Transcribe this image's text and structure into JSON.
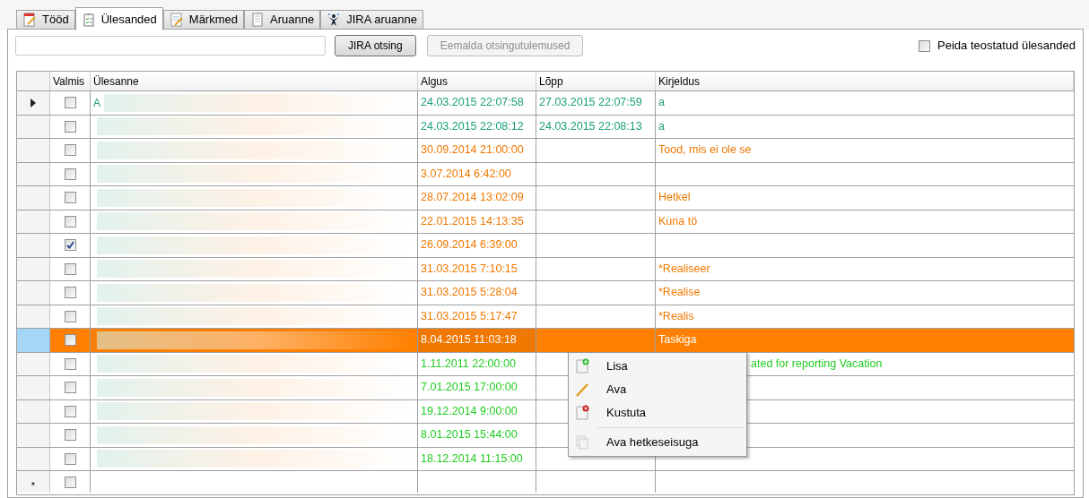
{
  "tabs": [
    {
      "label": "Tööd",
      "selected": false
    },
    {
      "label": "Ülesanded",
      "selected": true
    },
    {
      "label": "Märkmed",
      "selected": false
    },
    {
      "label": "Aruanne",
      "selected": false
    },
    {
      "label": "JIRA aruanne",
      "selected": false
    }
  ],
  "toolbar": {
    "buttons": [
      {
        "label": "JIRA otsing",
        "disabled": false
      },
      {
        "label": "Eemalda otsingutulemused",
        "disabled": true
      }
    ],
    "hide_done": {
      "label": "Peida teostatud ülesanded",
      "checked": false
    }
  },
  "grid": {
    "columns": [
      "Valmis",
      "Ülesanne",
      "Algus",
      "Lõpp",
      "Kirjeldus"
    ],
    "rows": [
      {
        "current": true,
        "selected": false,
        "done": false,
        "task": "A",
        "start": "24.03.2015 22:07:58",
        "end": "27.03.2015 22:07:59",
        "description": "a",
        "color": "#1a9e7a"
      },
      {
        "current": false,
        "selected": false,
        "done": false,
        "task": "",
        "start": "24.03.2015 22:08:12",
        "end": "24.03.2015 22:08:13",
        "description": "a",
        "color": "#1a9e7a"
      },
      {
        "current": false,
        "selected": false,
        "done": false,
        "task": "",
        "start": "30.09.2014 21:00:00",
        "end": "",
        "description": "Tood, mis ei ole se",
        "color": "#f07800"
      },
      {
        "current": false,
        "selected": false,
        "done": false,
        "task": "",
        "start": "3.07.2014 6:42:00",
        "end": "",
        "description": "",
        "color": "#f07800"
      },
      {
        "current": false,
        "selected": false,
        "done": false,
        "task": "",
        "start": "28.07.2014 13:02:09",
        "end": "",
        "description": "Hetkel",
        "color": "#f07800"
      },
      {
        "current": false,
        "selected": false,
        "done": false,
        "task": "",
        "start": "22.01.2015 14:13:35",
        "end": "",
        "description": "Kuna tö",
        "color": "#f07800"
      },
      {
        "current": false,
        "selected": false,
        "done": true,
        "task": "",
        "start": "26.09.2014 6:39:00",
        "end": "",
        "description": "",
        "color": "#f07800"
      },
      {
        "current": false,
        "selected": false,
        "done": false,
        "task": "",
        "start": "31.03.2015 7:10:15",
        "end": "",
        "description": "*Realiseer",
        "color": "#f07800"
      },
      {
        "current": false,
        "selected": false,
        "done": false,
        "task": "",
        "start": "31.03.2015 5:28:04",
        "end": "",
        "description": "*Realise",
        "color": "#f07800"
      },
      {
        "current": false,
        "selected": false,
        "done": false,
        "task": "",
        "start": "31.03.2015 5:17:47",
        "end": "",
        "description": "*Realis",
        "color": "#f07800"
      },
      {
        "current": false,
        "selected": true,
        "done": false,
        "task": "",
        "start": "8.04.2015 11:03:18",
        "end": "",
        "description": "Taskiga",
        "color": "#f07800"
      },
      {
        "current": false,
        "selected": false,
        "done": false,
        "task": "",
        "start": "1.11.2011 22:00:00",
        "end": "",
        "description": "ated for reporting Vacation",
        "description_start_hidden": true,
        "color": "#22cc22"
      },
      {
        "current": false,
        "selected": false,
        "done": false,
        "task": "",
        "start": "7.01.2015 17:00:00",
        "end": "",
        "description": "",
        "color": "#22cc22"
      },
      {
        "current": false,
        "selected": false,
        "done": false,
        "task": "",
        "start": "19.12.2014 9:00:00",
        "end": "",
        "description": "",
        "color": "#22cc22"
      },
      {
        "current": false,
        "selected": false,
        "done": false,
        "task": "",
        "start": "8.01.2015 15:44:00",
        "end": "",
        "description": "",
        "color": "#22cc22"
      },
      {
        "current": false,
        "selected": false,
        "done": false,
        "task": "",
        "start": "18.12.2014 11:15:00",
        "end": "",
        "description": "",
        "color": "#22cc22"
      }
    ],
    "new_row": {
      "marker": "*",
      "done": false
    }
  },
  "context_menu": [
    {
      "label": "Lisa",
      "kind": "add",
      "disabled": false
    },
    {
      "label": "Ava",
      "kind": "edit",
      "disabled": false
    },
    {
      "label": "Kustuta",
      "kind": "delete",
      "disabled": false
    },
    {
      "label": "Ava hetkeseisuga",
      "kind": "copy",
      "disabled": false
    }
  ]
}
